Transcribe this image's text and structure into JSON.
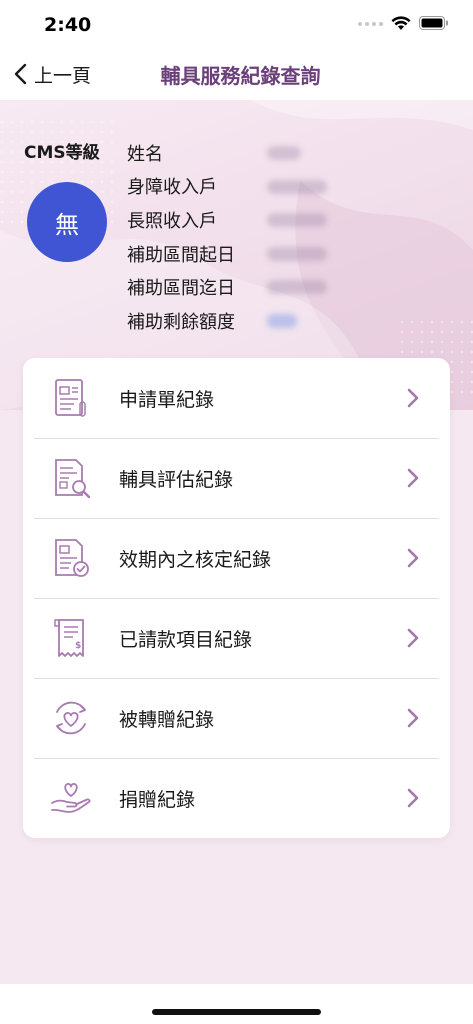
{
  "status_bar": {
    "time": "2:40"
  },
  "nav": {
    "back_label": "上一頁",
    "title": "輔具服務紀錄查詢"
  },
  "profile": {
    "cms_label": "CMS等級",
    "cms_value": "無",
    "fields": [
      {
        "label": "姓名"
      },
      {
        "label": "身障收入戶"
      },
      {
        "label": "長照收入戶"
      },
      {
        "label": "補助區間起日"
      },
      {
        "label": "補助區間迄日"
      },
      {
        "label": "補助剩餘額度"
      }
    ]
  },
  "menu": {
    "items": [
      {
        "label": "申請單紀錄",
        "icon": "application-form-icon"
      },
      {
        "label": "輔具評估紀錄",
        "icon": "evaluation-search-icon"
      },
      {
        "label": "效期內之核定紀錄",
        "icon": "approved-record-icon"
      },
      {
        "label": "已請款項目紀錄",
        "icon": "receipt-icon"
      },
      {
        "label": "被轉贈紀錄",
        "icon": "heart-transfer-icon"
      },
      {
        "label": "捐贈紀錄",
        "icon": "donation-hand-icon"
      }
    ]
  },
  "colors": {
    "accent": "#6b3f7a",
    "badge": "#3f55d4",
    "icon": "#a87bb0",
    "chevron": "#a07aa8"
  }
}
